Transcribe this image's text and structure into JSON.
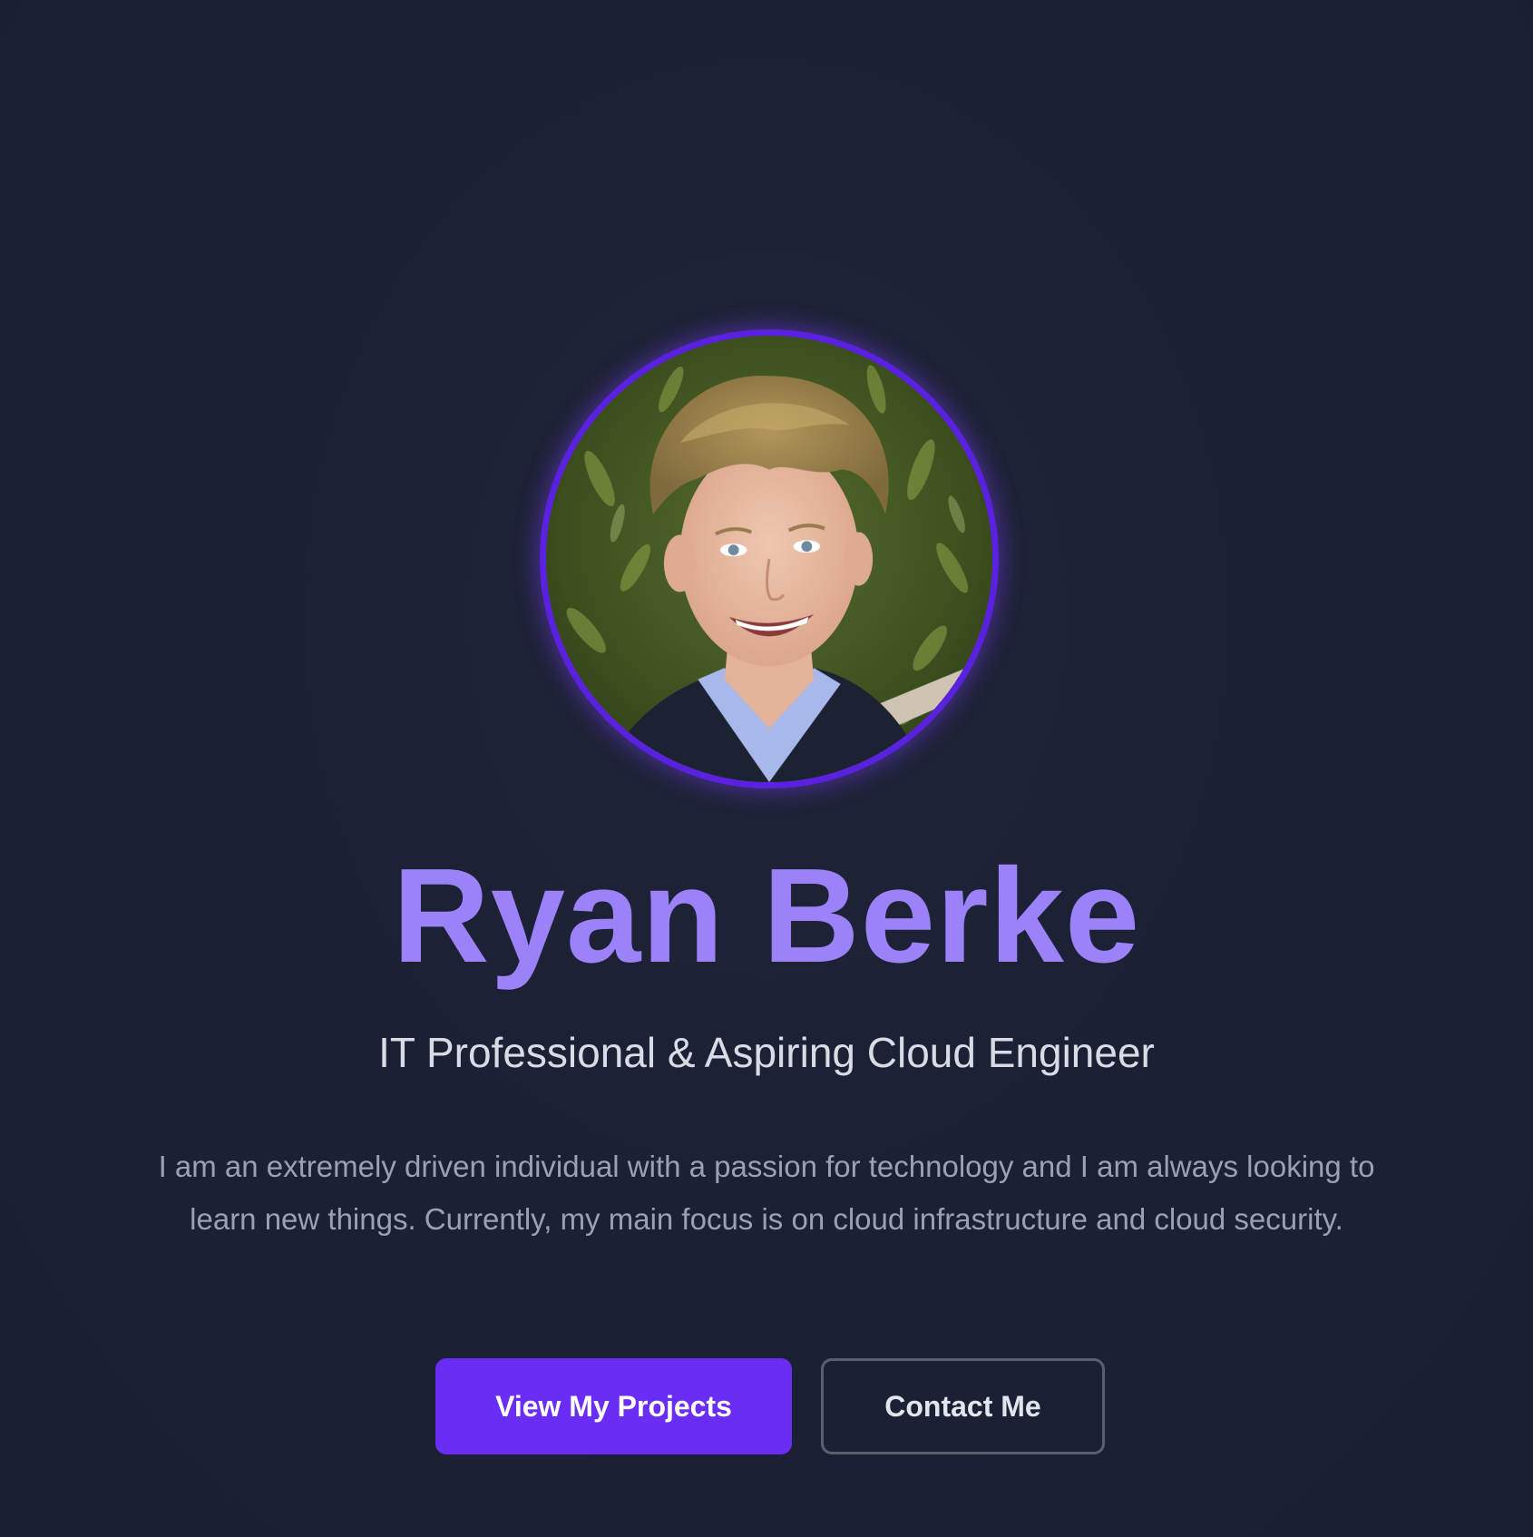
{
  "hero": {
    "name": "Ryan Berke",
    "subtitle": "IT Professional & Aspiring Cloud Engineer",
    "bio": "I am an extremely driven individual with a passion for technology and I am always looking to learn new things. Currently, my main focus is on cloud infrastructure and cloud security.",
    "buttons": {
      "primary_label": "View My Projects",
      "secondary_label": "Contact Me"
    },
    "avatar_alt": "Ryan Berke"
  },
  "colors": {
    "background": "#1c2034",
    "accent": "#9b82f8",
    "primary_button": "#6a2df6",
    "avatar_ring": "#5a22e0"
  }
}
